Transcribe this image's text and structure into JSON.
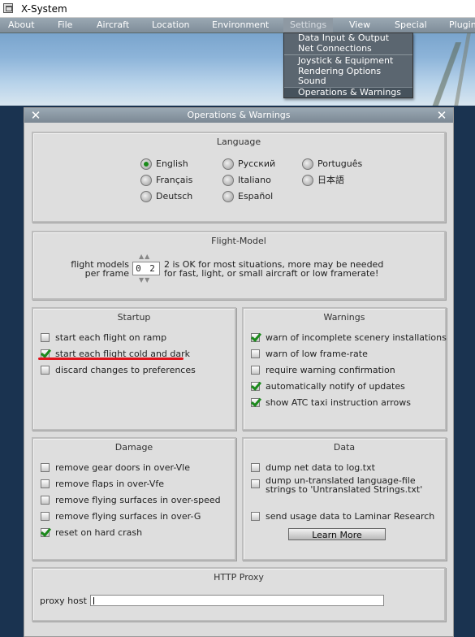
{
  "titlebar": {
    "title": "X-System"
  },
  "menu": {
    "items": [
      "About",
      "File",
      "Aircraft",
      "Location",
      "Environment",
      "Settings",
      "View",
      "Special",
      "Plugin"
    ],
    "active": "Settings"
  },
  "dropdown": {
    "items": [
      "Data Input & Output",
      "Net Connections",
      "Joystick & Equipment",
      "Rendering Options",
      "Sound",
      "Operations & Warnings"
    ],
    "highlighted": "Operations & Warnings"
  },
  "window": {
    "title": "Operations & Warnings",
    "close_left": "✕",
    "close_right": "✕"
  },
  "language": {
    "title": "Language",
    "options": [
      "English",
      "Русский",
      "Português",
      "Français",
      "Italiano",
      "日本語",
      "Deutsch",
      "Español"
    ],
    "selected": "English"
  },
  "flight_model": {
    "title": "Flight-Model",
    "label_line1": "flight models",
    "label_line2": "per frame",
    "value": "0 2",
    "note_line1": "2 is OK for most situations, more may be needed",
    "note_line2": "for fast, light, or small aircraft or low framerate!"
  },
  "startup": {
    "title": "Startup",
    "items": [
      {
        "label": "start each flight on ramp",
        "checked": false
      },
      {
        "label": "start each flight cold and dark",
        "checked": true
      },
      {
        "label": "discard changes to preferences",
        "checked": false
      }
    ]
  },
  "warnings": {
    "title": "Warnings",
    "items": [
      {
        "label": "warn of incomplete scenery installations",
        "checked": true
      },
      {
        "label": "warn of low frame-rate",
        "checked": false
      },
      {
        "label": "require warning confirmation",
        "checked": false
      },
      {
        "label": "automatically notify of updates",
        "checked": true
      },
      {
        "label": "show ATC taxi instruction arrows",
        "checked": true
      }
    ]
  },
  "damage": {
    "title": "Damage",
    "items": [
      {
        "label": "remove gear doors in over-Vle",
        "checked": false
      },
      {
        "label": "remove flaps in over-Vfe",
        "checked": false
      },
      {
        "label": "remove flying surfaces in over-speed",
        "checked": false
      },
      {
        "label": "remove flying surfaces in over-G",
        "checked": false
      },
      {
        "label": "reset on hard crash",
        "checked": true
      }
    ]
  },
  "data_panel": {
    "title": "Data",
    "items": [
      {
        "label": "dump net data to log.txt",
        "checked": false
      },
      {
        "label": "dump un-translated language-file",
        "label2": "strings to 'Untranslated Strings.txt'",
        "checked": false
      },
      {
        "label": "send usage data to Laminar Research",
        "checked": false
      }
    ],
    "learn_more": "Learn More"
  },
  "proxy": {
    "title": "HTTP Proxy",
    "label": "proxy host",
    "value": ""
  }
}
